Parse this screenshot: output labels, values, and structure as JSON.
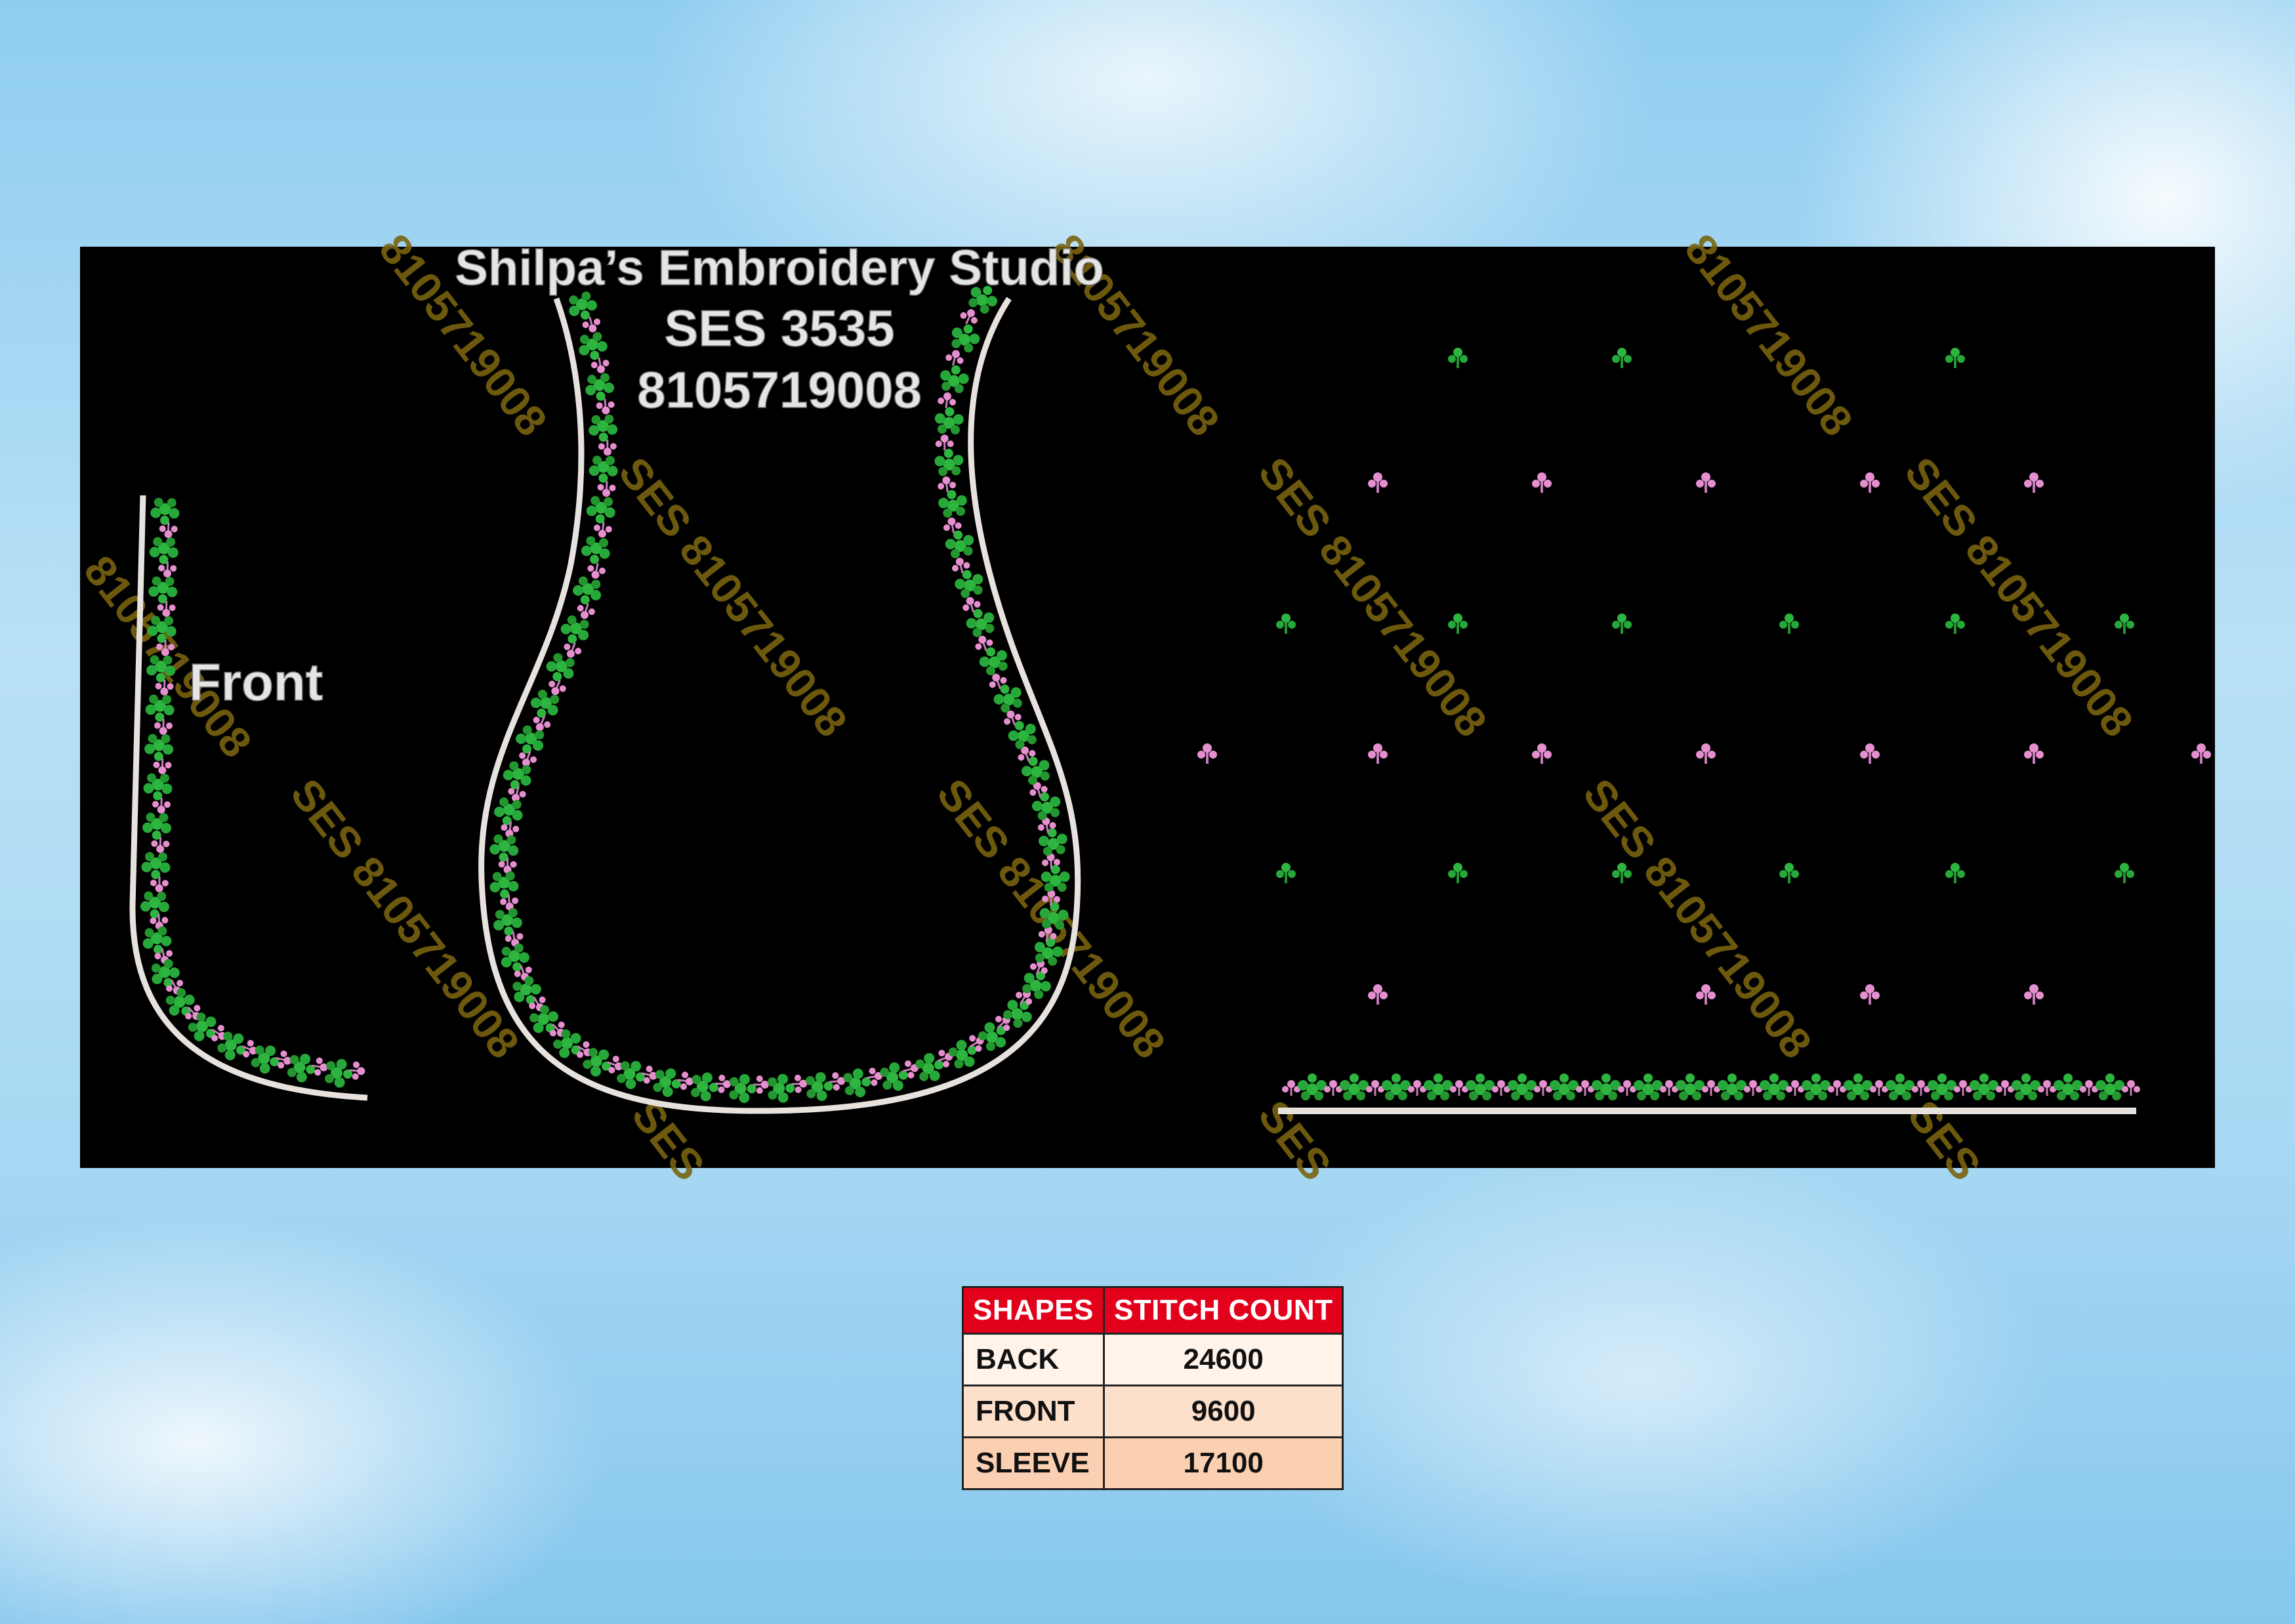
{
  "header": {
    "studio_name": "Shilpa’s  Embroidery  Studio",
    "design_code": "SES  3535",
    "phone": "8105719008"
  },
  "front_label": "Front",
  "watermark": {
    "text": "SES 8105719008",
    "partial_text_1": "8105719008",
    "partial_text_2": "SES"
  },
  "colors": {
    "panel": "#000000",
    "outline": "#e8e2df",
    "leaf_green": "#27a83a",
    "bud_pink": "#e58fcf",
    "watermark": "#7a6410",
    "table_header": "#e3001b"
  },
  "stitch_table": {
    "headers": [
      "SHAPES",
      "STITCH COUNT"
    ],
    "rows": [
      {
        "shape": "BACK",
        "count": "24600"
      },
      {
        "shape": "FRONT",
        "count": "9600"
      },
      {
        "shape": "SLEEVE",
        "count": "17100"
      }
    ]
  }
}
